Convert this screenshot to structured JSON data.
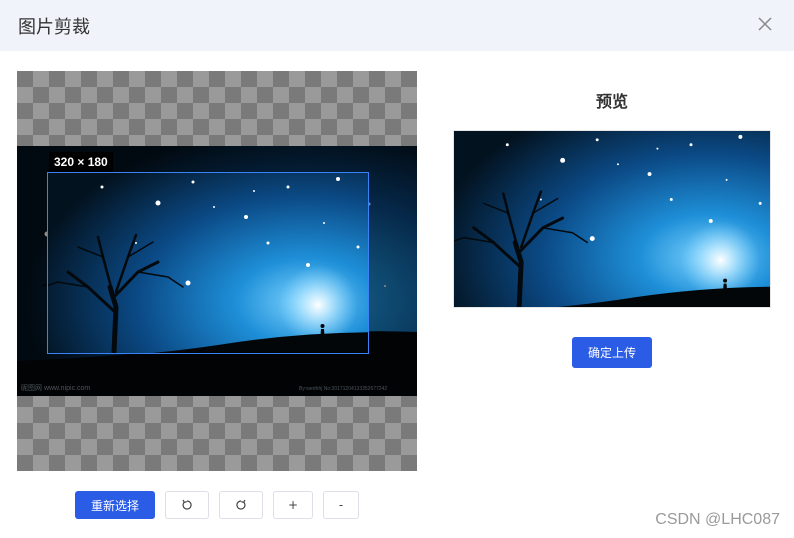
{
  "dialog": {
    "title": "图片剪裁",
    "close_icon": "close-icon"
  },
  "cropper": {
    "size_label": "320 × 180",
    "image_caption_left": "昵图网 www.nipic.com",
    "image_caption_right": "By:werthhj No:20171204133352677242"
  },
  "toolbar": {
    "reselect_label": "重新选择",
    "rotate_left_icon": "rotate-left-icon",
    "rotate_right_icon": "rotate-right-icon",
    "zoom_in_label": "+",
    "zoom_out_label": "-"
  },
  "preview": {
    "title": "预览",
    "upload_label": "确定上传"
  },
  "watermark": "CSDN @LHC087",
  "colors": {
    "primary": "#2b5ce6",
    "header_bg": "#f1f3fb",
    "crop_border": "#3b82f6"
  }
}
